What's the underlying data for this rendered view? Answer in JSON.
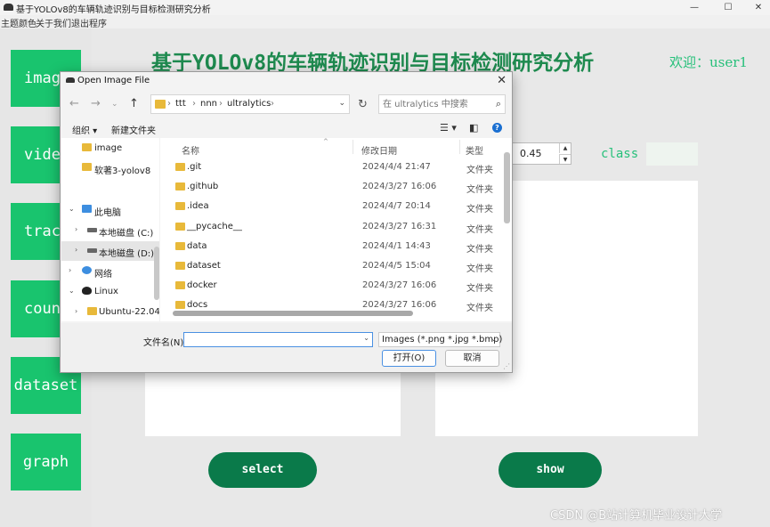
{
  "window": {
    "title": "基于YOLOv8的车辆轨迹识别与目标检测研究分析",
    "controls": [
      "—",
      "☐",
      "✕"
    ]
  },
  "menu": [
    "主题颜色",
    "关于我们",
    "退出程序"
  ],
  "sidebar": {
    "buttons": [
      "image",
      "video",
      "track",
      "count",
      "dataset",
      "graph"
    ]
  },
  "header": {
    "title": "基于YOLOv8的车辆轨迹识别与目标检测研究分析",
    "welcome": "欢迎：user1"
  },
  "controls": {
    "confidence_value": "0.45",
    "class_label": "class",
    "class_value": ""
  },
  "actions": {
    "select_label": "select",
    "show_label": "show"
  },
  "watermark": "CSDN @B站计算机毕业设计大学",
  "dialog": {
    "title": "Open Image File",
    "path": [
      "ttt",
      "nnn",
      "ultralytics"
    ],
    "search_placeholder": "在 ultralytics 中搜索",
    "toolbar": {
      "organize": "组织 ▾",
      "new_folder": "新建文件夹"
    },
    "nav_items": [
      {
        "label": "image",
        "icon": "folder-icon"
      },
      {
        "label": "软著3-yolov8",
        "icon": "folder-icon"
      },
      {
        "label": "此电脑",
        "icon": "computer-icon"
      },
      {
        "label": "本地磁盘 (C:)",
        "icon": "drive-icon"
      },
      {
        "label": "本地磁盘 (D:)",
        "icon": "drive-icon"
      },
      {
        "label": "网络",
        "icon": "network-icon"
      },
      {
        "label": "Linux",
        "icon": "linux-icon"
      },
      {
        "label": "Ubuntu-22.04",
        "icon": "folder-icon"
      }
    ],
    "columns": {
      "name": "名称",
      "date": "修改日期",
      "type": "类型"
    },
    "files": [
      {
        "name": ".git",
        "date": "2024/4/4 21:47",
        "type": "文件夹"
      },
      {
        "name": ".github",
        "date": "2024/3/27 16:06",
        "type": "文件夹"
      },
      {
        "name": ".idea",
        "date": "2024/4/7 20:14",
        "type": "文件夹"
      },
      {
        "name": "__pycache__",
        "date": "2024/3/27 16:31",
        "type": "文件夹"
      },
      {
        "name": "data",
        "date": "2024/4/1 14:43",
        "type": "文件夹"
      },
      {
        "name": "dataset",
        "date": "2024/4/5 15:04",
        "type": "文件夹"
      },
      {
        "name": "docker",
        "date": "2024/3/27 16:06",
        "type": "文件夹"
      },
      {
        "name": "docs",
        "date": "2024/3/27 16:06",
        "type": "文件夹"
      }
    ],
    "filename_label": "文件名(N):",
    "filename_value": "",
    "filter": "Images (*.png *.jpg *.bmp)",
    "open_label": "打开(O)",
    "cancel_label": "取消"
  },
  "colors": {
    "sidebar_button": "#19c46e",
    "title_green": "#1e8a4f",
    "pill_green": "#0a7a4a",
    "welcome_green": "#26c07a"
  }
}
